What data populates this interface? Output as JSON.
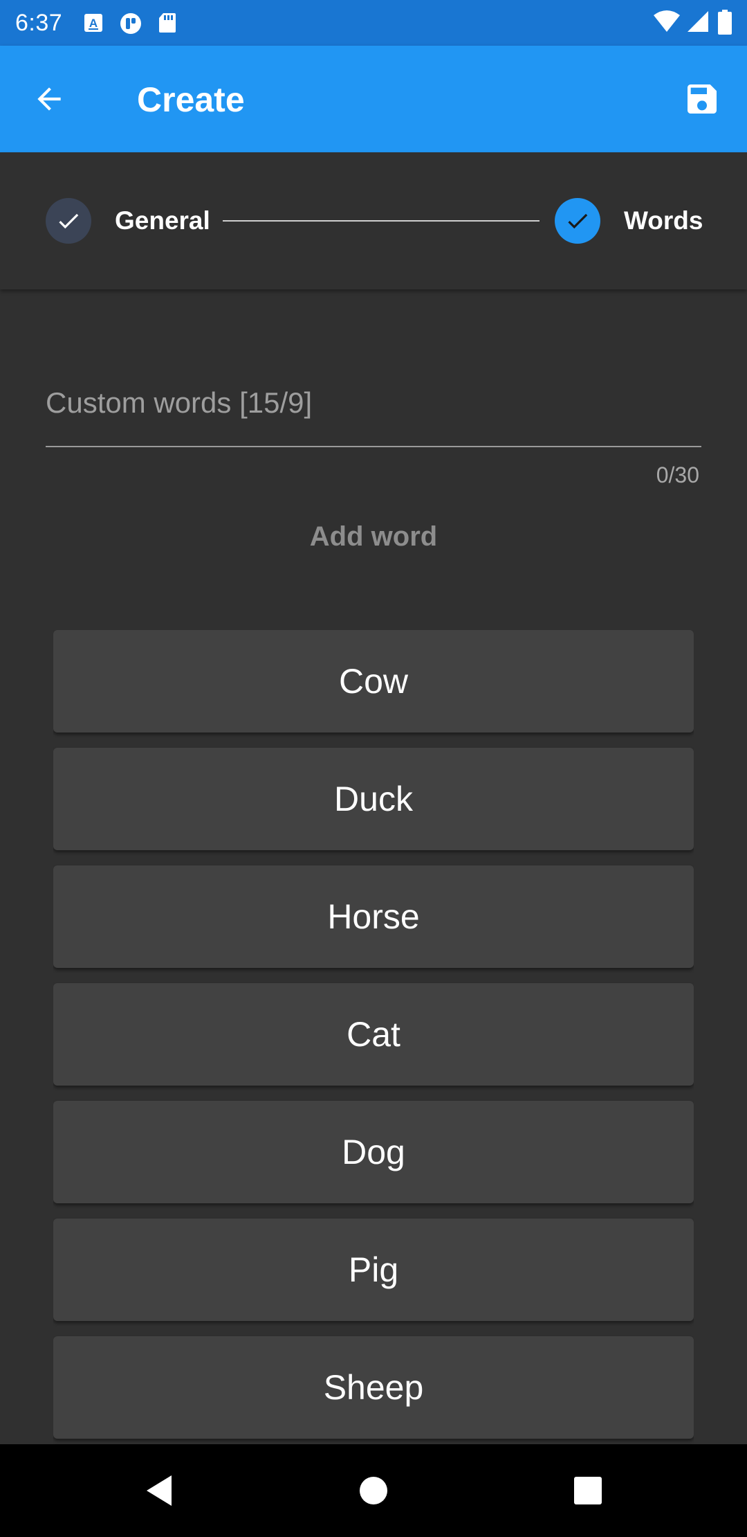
{
  "status_bar": {
    "time": "6:37",
    "left_icons": [
      "keyboard-a-icon",
      "notification-app-icon",
      "sd-card-icon"
    ],
    "right_icons": [
      "wifi-icon",
      "cellular-signal-icon",
      "battery-icon"
    ]
  },
  "app_bar": {
    "title": "Create",
    "back_icon": "arrow-back-icon",
    "save_icon": "save-floppy-icon",
    "background": "#2196F3"
  },
  "stepper": {
    "steps": [
      {
        "label": "General",
        "completed": true,
        "color": "#3B4456"
      },
      {
        "label": "Words",
        "completed": true,
        "color": "#2196F3"
      }
    ]
  },
  "input": {
    "placeholder": "Custom words [15/9]",
    "value": "",
    "counter": "0/30"
  },
  "add_word": {
    "label": "Add word"
  },
  "words": [
    "Cow",
    "Duck",
    "Horse",
    "Cat",
    "Dog",
    "Pig",
    "Sheep"
  ],
  "nav_bar": {
    "buttons": [
      "back-triangle-icon",
      "home-circle-icon",
      "recents-square-icon"
    ]
  }
}
